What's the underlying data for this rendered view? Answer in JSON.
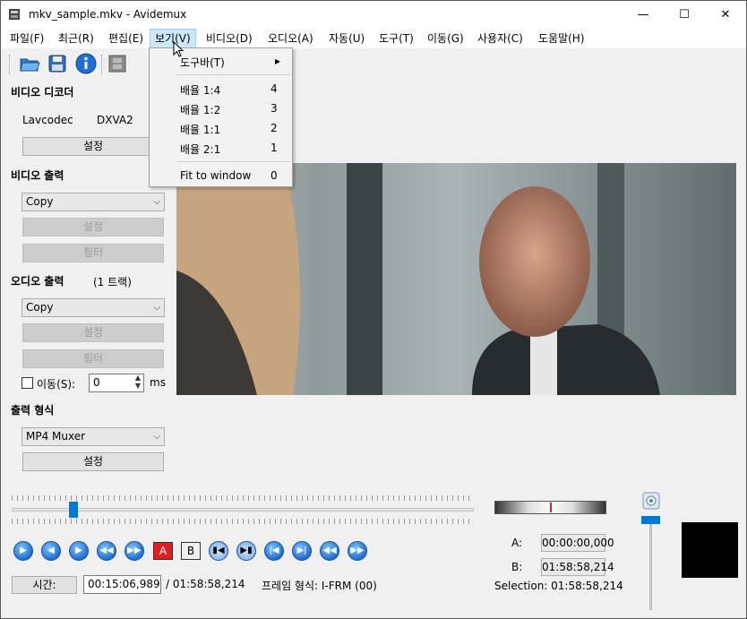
{
  "window": {
    "title": "mkv_sample.mkv - Avidemux",
    "minimize_glyph": "—",
    "maximize_glyph": "☐",
    "close_glyph": "✕"
  },
  "menubar": [
    "파일(F)",
    "최근(R)",
    "편집(E)",
    "보기(V)",
    "비디오(D)",
    "오디오(A)",
    "자동(U)",
    "도구(T)",
    "이동(G)",
    "사용자(C)",
    "도움말(H)"
  ],
  "view_menu": {
    "items": [
      {
        "label": "도구바(T)",
        "shortcut": "▸"
      },
      {
        "label": "배율 1:4",
        "shortcut": "4"
      },
      {
        "label": "배율 1:2",
        "shortcut": "3"
      },
      {
        "label": "배율 1:1",
        "shortcut": "2"
      },
      {
        "label": "배율 2:1",
        "shortcut": "1"
      },
      {
        "label": "Fit to window",
        "shortcut": "0"
      }
    ]
  },
  "left_panel": {
    "video_decoder_title": "비디오 디코더",
    "decoder_name": "Lavcodec",
    "decoder_hw": "DXVA2",
    "decoder_settings": "설정",
    "video_output_title": "비디오 출력",
    "video_output_value": "Copy",
    "video_settings": "설정",
    "video_filter": "필터",
    "audio_output_title": "오디오 출력",
    "audio_tracks": "(1 트랙)",
    "audio_output_value": "Copy",
    "audio_settings": "설정",
    "audio_filter": "필터",
    "shift_label": "이동(S):",
    "shift_value": "0",
    "shift_unit": "ms",
    "output_format_title": "출력 형식",
    "output_format_value": "MP4 Muxer",
    "format_settings": "설정"
  },
  "bottom": {
    "time_button": "시간:",
    "current_time": "00:15:06,989",
    "total_time": "/ 01:58:58,214",
    "frame_type": "프레임 형식: I-FRM (00)",
    "a_label": "A:",
    "a_value": "00:00:00,000",
    "b_label": "B:",
    "b_value": "01:58:58,214",
    "selection": "Selection: 01:58:58,214",
    "marker_a": "A",
    "marker_b": "B",
    "nav_glyphs": [
      "▶",
      "◀",
      "▶",
      "◀◀",
      "▶▶",
      "▮◀",
      "▶▮",
      "|◀",
      "▶|",
      "◀◀",
      "▶▶"
    ]
  },
  "colors": {
    "accent": "#0078d7",
    "menu_highlight": "#cce8ff",
    "marker_red": "#e02020"
  }
}
